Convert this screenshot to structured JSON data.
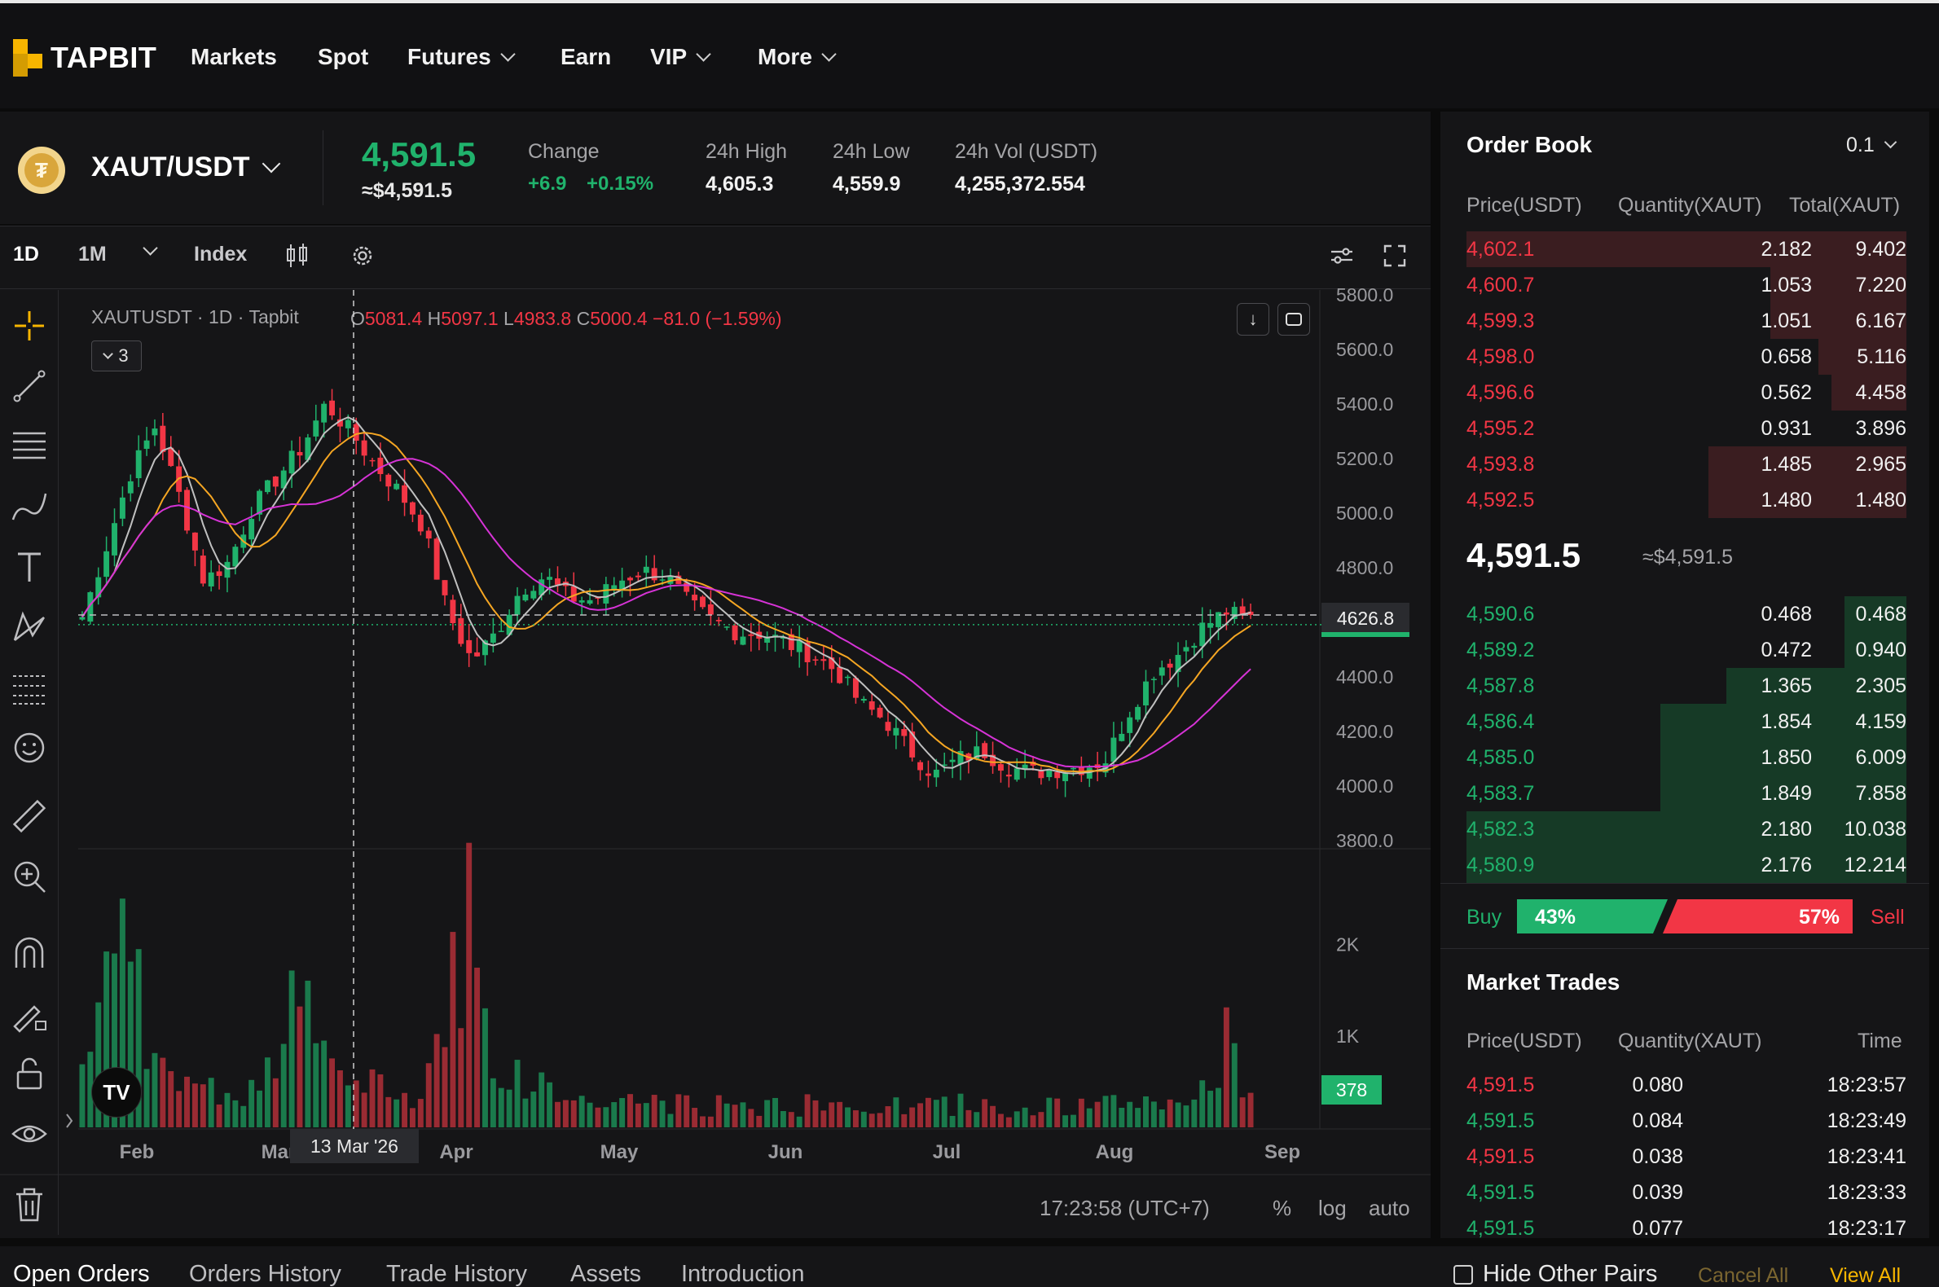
{
  "brand": {
    "name": "TAPBIT",
    "logo_color": "#f7b500"
  },
  "nav": {
    "items": [
      {
        "label": "Markets",
        "dropdown": false
      },
      {
        "label": "Spot",
        "dropdown": false
      },
      {
        "label": "Futures",
        "dropdown": true
      },
      {
        "label": "Earn",
        "dropdown": false
      },
      {
        "label": "VIP",
        "dropdown": true
      },
      {
        "label": "More",
        "dropdown": true
      }
    ]
  },
  "ticker": {
    "pair": "XAUT/USDT",
    "last_price": "4,591.5",
    "last_price_usd": "≈$4,591.5",
    "change_label": "Change",
    "change_value": "+6.9",
    "change_pct": "+0.15%",
    "high_label": "24h High",
    "high_value": "4,605.3",
    "low_label": "24h Low",
    "low_value": "4,559.9",
    "vol_label": "24h Vol (USDT)",
    "vol_value": "4,255,372.554"
  },
  "toolbar": {
    "interval_1d": "1D",
    "interval_1m": "1M",
    "index_label": "Index"
  },
  "chart": {
    "symbol_label": "XAUTUSDT",
    "interval_label": "1D",
    "source_label": "Tapbit",
    "ohlc": {
      "o": "5081.4",
      "h": "5097.1",
      "l": "4983.8",
      "c": "5000.4",
      "chg": "−81.0 (−1.59%)"
    },
    "indicator_count": "3",
    "crosshair_date": "13 Mar '26",
    "current_price_tag": "4626.8",
    "volume_tag": "378",
    "clock": "17:23:58 (UTC+7)",
    "scale_pct": "%",
    "scale_log": "log",
    "scale_auto": "auto",
    "colors": {
      "up": "#20b26c",
      "down": "#f23645",
      "ma_fast": "#c0c0c0",
      "ma_mid": "#f5a623",
      "ma_slow": "#d633d6"
    }
  },
  "chart_data": {
    "type": "candlestick",
    "symbol": "XAUTUSDT",
    "interval": "1D",
    "x_ticks": [
      "Feb",
      "Mar",
      "Apr",
      "May",
      "Jun",
      "Jul",
      "Aug",
      "Sep"
    ],
    "price_axis_ticks": [
      "5800.0",
      "5600.0",
      "5400.0",
      "5200.0",
      "5000.0",
      "4800.0",
      "4400.0",
      "4200.0",
      "4000.0",
      "3800.0"
    ],
    "ylim": [
      3800,
      5800
    ],
    "volume_axis_ticks": [
      "2K",
      "1K"
    ],
    "close_series_approx": [
      4620,
      4880,
      5150,
      5320,
      5060,
      4750,
      4820,
      5020,
      5130,
      5240,
      5400,
      5300,
      5180,
      5080,
      4950,
      4640,
      4460,
      4560,
      4720,
      4770,
      4690,
      4680,
      4750,
      4790,
      4770,
      4660,
      4600,
      4560,
      4560,
      4520,
      4480,
      4420,
      4300,
      4240,
      4130,
      4040,
      4100,
      4130,
      4070,
      4050,
      4060,
      4070,
      4090,
      4270,
      4420,
      4480,
      4580,
      4640,
      4600
    ],
    "last_close": 4626.8,
    "volume_series_approx": [
      500,
      2100,
      1500,
      900,
      600,
      400,
      350,
      500,
      700,
      1500,
      800,
      400,
      450,
      350,
      300,
      1600,
      2600,
      600,
      500,
      450,
      300,
      280,
      260,
      300,
      250,
      240,
      230,
      260,
      240,
      220,
      250,
      210,
      260,
      230,
      220,
      240,
      250,
      230,
      220,
      210,
      230,
      220,
      240,
      260,
      280,
      300,
      350,
      1050,
      378
    ]
  },
  "orderbook": {
    "title": "Order Book",
    "precision": "0.1",
    "col_price": "Price(USDT)",
    "col_qty": "Quantity(XAUT)",
    "col_total": "Total(XAUT)",
    "asks": [
      {
        "price": "4,602.1",
        "qty": "2.182",
        "total": "9.402",
        "depth": 1.0
      },
      {
        "price": "4,600.7",
        "qty": "1.053",
        "total": "7.220",
        "depth": 0.31
      },
      {
        "price": "4,599.3",
        "qty": "1.051",
        "total": "6.167",
        "depth": 0.31
      },
      {
        "price": "4,598.0",
        "qty": "0.658",
        "total": "5.116",
        "depth": 0.2
      },
      {
        "price": "4,596.6",
        "qty": "0.562",
        "total": "4.458",
        "depth": 0.17
      },
      {
        "price": "4,595.2",
        "qty": "0.931",
        "total": "3.896",
        "depth": 0.0
      },
      {
        "price": "4,593.8",
        "qty": "1.485",
        "total": "2.965",
        "depth": 0.45
      },
      {
        "price": "4,592.5",
        "qty": "1.480",
        "total": "1.480",
        "depth": 0.45
      }
    ],
    "mid_price": "4,591.5",
    "mid_price_usd": "≈$4,591.5",
    "bids": [
      {
        "price": "4,590.6",
        "qty": "0.468",
        "total": "0.468",
        "depth": 0.14
      },
      {
        "price": "4,589.2",
        "qty": "0.472",
        "total": "0.940",
        "depth": 0.14
      },
      {
        "price": "4,587.8",
        "qty": "1.365",
        "total": "2.305",
        "depth": 0.41
      },
      {
        "price": "4,586.4",
        "qty": "1.854",
        "total": "4.159",
        "depth": 0.56
      },
      {
        "price": "4,585.0",
        "qty": "1.850",
        "total": "6.009",
        "depth": 0.56
      },
      {
        "price": "4,583.7",
        "qty": "1.849",
        "total": "7.858",
        "depth": 0.56
      },
      {
        "price": "4,582.3",
        "qty": "2.180",
        "total": "10.038",
        "depth": 1.0
      },
      {
        "price": "4,580.9",
        "qty": "2.176",
        "total": "12.214",
        "depth": 1.0
      }
    ],
    "buy_label": "Buy",
    "buy_pct": "43%",
    "buy_fraction": 0.43,
    "sell_label": "Sell",
    "sell_pct": "57%"
  },
  "market_trades": {
    "title": "Market Trades",
    "col_price": "Price(USDT)",
    "col_qty": "Quantity(XAUT)",
    "col_time": "Time",
    "rows": [
      {
        "price": "4,591.5",
        "qty": "0.080",
        "time": "18:23:57",
        "side": "sell"
      },
      {
        "price": "4,591.5",
        "qty": "0.084",
        "time": "18:23:49",
        "side": "buy"
      },
      {
        "price": "4,591.5",
        "qty": "0.038",
        "time": "18:23:41",
        "side": "sell"
      },
      {
        "price": "4,591.5",
        "qty": "0.039",
        "time": "18:23:33",
        "side": "buy"
      },
      {
        "price": "4,591.5",
        "qty": "0.077",
        "time": "18:23:17",
        "side": "buy"
      }
    ]
  },
  "bottom": {
    "tabs": [
      "Open Orders",
      "Orders History",
      "Trade History",
      "Assets",
      "Introduction"
    ],
    "hide_other_pairs": "Hide Other Pairs",
    "cancel_all": "Cancel All",
    "view_all": "View All"
  }
}
